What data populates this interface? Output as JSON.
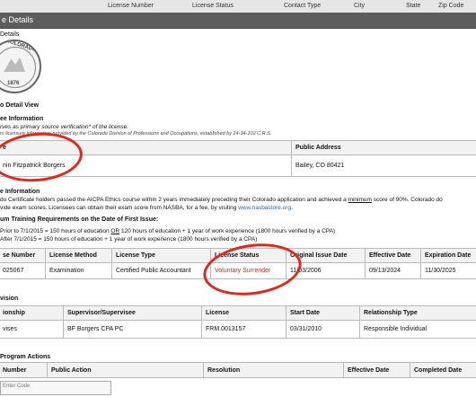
{
  "bg_table": {
    "headers": [
      "License Number",
      "License Status",
      "Contact Type",
      "City",
      "State",
      "Zip Code"
    ]
  },
  "window": {
    "title": "e Details"
  },
  "seal": {
    "label": "Details",
    "text_top": "COLORADO",
    "year": "1876"
  },
  "view_title": "o Detail View",
  "verification": {
    "heading": "ee Information",
    "line1": "rves as primary source verification* of the license.",
    "line2": "rs licensure information provided by the Colorado Division of Professions and Occupations, established by 24-34-102 C.R.S."
  },
  "licensee_table": {
    "headers": [
      "e",
      "Public Address"
    ],
    "row": [
      "nin Fitzpatrick Borgers",
      "Bailey, CO 80421"
    ]
  },
  "license_info": {
    "heading": "e Information",
    "line1_a": "do Certificate holders passed the AICPA Ethics course within 2 years immediately preceding their Colorado application and achieved a ",
    "line1_u": "minimum",
    "line1_b": " score of 90%. Colorado do",
    "line2_a": "vide exam scores. Licensees can obtain their exam score from NASBA, for a fee, by visiting ",
    "line2_link": "www.nasbastore.org",
    "line2_b": "."
  },
  "training": {
    "heading": "um Training Requirements on the Date of First Issue:",
    "line1_a": "Prior to 7/1/2015 = 150 hours of education ",
    "line1_or": "OR",
    "line1_b": " 120 hours of education + 1 year of work experience (1800 hours verified by a CPA)",
    "line2": "After 7/1/2015 = 150 hours of education + 1 year of work experience (1800 hours verified by a CPA)"
  },
  "license_table": {
    "headers": [
      "se Number",
      "License Method",
      "License Type",
      "License Status",
      "Original Issue Date",
      "Effective Date",
      "Expiration Date"
    ],
    "row": [
      "025067",
      "Examination",
      "Certified Public Accountant",
      "Voluntary Surrender",
      "11/03/2006",
      "09/13/2024",
      "11/30/2025"
    ]
  },
  "supervision": {
    "heading": "vision",
    "headers": [
      "ionship",
      "Supervisor/Supervisee",
      "License",
      "Start Date",
      "Relationship Type"
    ],
    "row": [
      "vises",
      "BF Borgers CPA PC",
      "FRM.0013157",
      "03/31/2010",
      "Responsible Individual"
    ]
  },
  "public_actions": {
    "heading": "Program Actions",
    "headers": [
      "Number",
      "Public Action",
      "Resolution",
      "Effective Date",
      "Completed Date"
    ],
    "partial_row": "Enter Code"
  },
  "annotation_color": "#e0281c",
  "status_color": "#cc2b1d"
}
